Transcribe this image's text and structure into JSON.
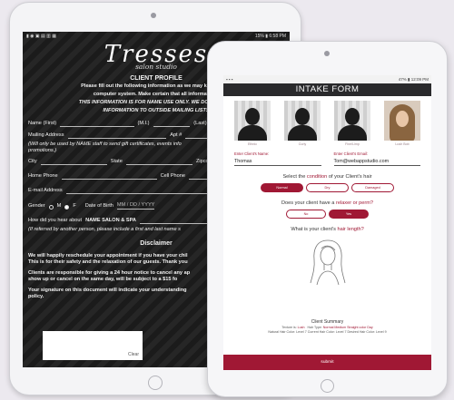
{
  "back_tablet": {
    "status_left": "▮ ◉ ▣ ▤ ▥ ▦",
    "status_right": "15% ▮ 6:58 PM",
    "logo_main": "Tresses",
    "logo_sub": "salon studio",
    "title": "CLIENT PROFILE",
    "intro_lines": [
      "Please fill out the following information as we may keep our re",
      "computer system.  Make certain that all information i"
    ],
    "intro_italic_lines": [
      "THIS INFORMATION IS FOR NAME USE ONLY.  WE DO NOT DIST",
      "INFORMATION TO OUTSIDE MAILING LISTS"
    ],
    "name_first": "Name (First)",
    "name_mi": "(M.I.)",
    "name_last": "(Last)",
    "mailing_address": "Mailing Address",
    "apt": "Apt #",
    "mail_note_1": "(Will only be used by NAME staff to send gift certificates, events info",
    "mail_note_2": "promotions.)",
    "city": "City",
    "state": "State",
    "zipcode": "Zipcode",
    "home_phone": "Home Phone",
    "cell_phone": "Cell Phone",
    "email": "E-mail Address",
    "gender": "Gender",
    "gender_m": "M",
    "gender_f": "F",
    "dob": "Date of Birth",
    "dob_placeholder": "MM / DD / YYYY",
    "heard_about": "How did you hear about",
    "heard_about_value": "NAME SALON & SPA",
    "referral_note": "(If referred by another person, please include a first and last name s",
    "disclaimer_title": "Disclaimer",
    "disclaimer_p1_l1": "We will happily reschedule your appointment if you have your chil",
    "disclaimer_p1_l2": "This is for their safety and the relaxation of our guests.  Thank you",
    "disclaimer_p2_l1": "Clients are responsible for giving a 24 hour notice to cancel any ap",
    "disclaimer_p2_l2": "show up or cancel on the same day, will be subject to a $15 fo",
    "disclaimer_p3_l1": "Your signature on this document will indicate your understanding",
    "disclaimer_p3_l2": "policy.",
    "sign_clear": "Clear"
  },
  "front_tablet": {
    "status_left": "▪ ▪ ▪",
    "status_right": "47% ▮ 12:09 PM",
    "header": "INTAKE FORM",
    "photos": [
      {
        "caption": "Ethnic",
        "kind": "silhouette"
      },
      {
        "caption": "Curly",
        "kind": "silhouette"
      },
      {
        "caption": "Fine/Limp",
        "kind": "silhouette"
      },
      {
        "caption": "Lush Bob",
        "kind": "photo"
      }
    ],
    "name_label": "Enter Client's Name:",
    "name_value": "Thomas",
    "email_label": "Enter Client's Email:",
    "email_value": "Tom@webappstudio.com",
    "q_condition_pre": "Select the",
    "q_condition_accent": "condition",
    "q_condition_post": "of your Client's hair",
    "condition_options": [
      {
        "label": "Normal",
        "selected": true
      },
      {
        "label": "Dry",
        "selected": false
      },
      {
        "label": "Damaged",
        "selected": false
      }
    ],
    "q_relaxer_pre": "Does your client have a",
    "q_relaxer_accent": "relaxer or perm?",
    "relaxer_options": [
      {
        "label": "No",
        "selected": false
      },
      {
        "label": "Yes",
        "selected": true
      }
    ],
    "q_length_pre": "What is your client's",
    "q_length_accent": "hair length?",
    "summary_title": "Client Summary",
    "summary_line1_label": "Texture is:",
    "summary_line1_value": "Lush",
    "summary_line1_label2": "Hair Type:",
    "summary_line1_value2": "Normal  Medium  Straight  color Day",
    "summary_line2": "Natural Hair Color:  Level 7    Current Hair Color:  Level 7    Desired Hair Color:  Level 9",
    "submit": "submit",
    "colors": {
      "accent": "#a01834",
      "header_bg": "#2a2a2c"
    }
  }
}
